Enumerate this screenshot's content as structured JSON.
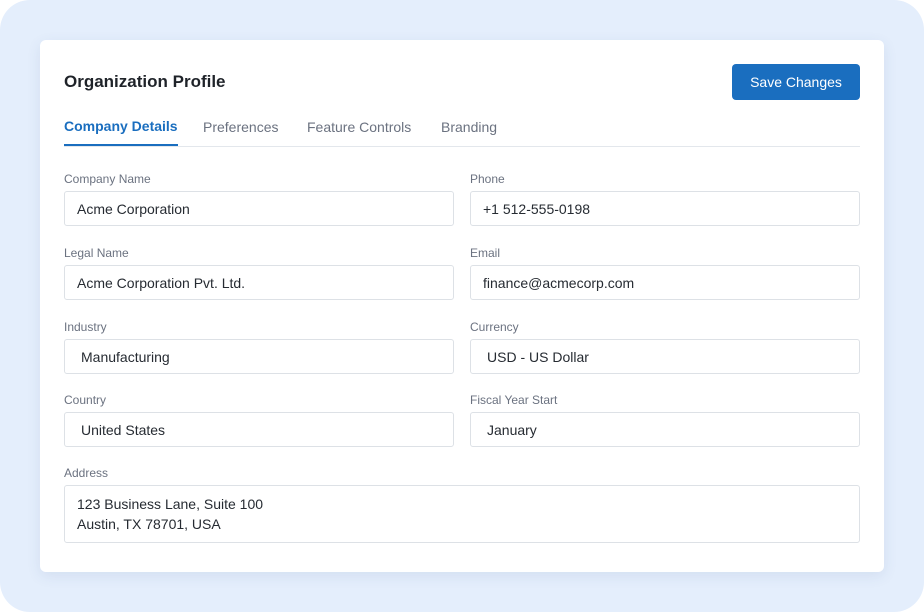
{
  "header": {
    "title": "Organization Profile",
    "save_label": "Save Changes"
  },
  "tabs": [
    {
      "label": "Company Details",
      "active": true
    },
    {
      "label": "Preferences",
      "active": false
    },
    {
      "label": "Feature Controls",
      "active": false
    },
    {
      "label": "Branding",
      "active": false
    }
  ],
  "form": {
    "company_name": {
      "label": "Company Name",
      "value": "Acme Corporation"
    },
    "phone": {
      "label": "Phone",
      "value": "+1 512-555-0198"
    },
    "legal_name": {
      "label": "Legal Name",
      "value": "Acme Corporation Pvt. Ltd."
    },
    "email": {
      "label": "Email",
      "value": "finance@acmecorp.com"
    },
    "industry": {
      "label": "Industry",
      "value": "Manufacturing"
    },
    "currency": {
      "label": "Currency",
      "value": "USD - US Dollar"
    },
    "country": {
      "label": "Country",
      "value": "United States"
    },
    "fiscal_year_start": {
      "label": "Fiscal Year Start",
      "value": "January"
    },
    "address": {
      "label": "Address",
      "lines": [
        "123 Business Lane, Suite 100",
        "Austin, TX 78701, USA"
      ]
    }
  },
  "colors": {
    "accent": "#1a6ebf",
    "background": "#e4eefc",
    "card": "#ffffff"
  }
}
